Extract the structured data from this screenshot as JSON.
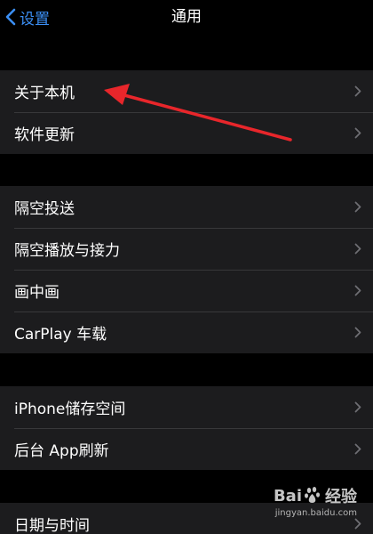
{
  "header": {
    "back_label": "设置",
    "title": "通用"
  },
  "groups": [
    {
      "items": [
        {
          "label": "关于本机"
        },
        {
          "label": "软件更新"
        }
      ]
    },
    {
      "items": [
        {
          "label": "隔空投送"
        },
        {
          "label": "隔空播放与接力"
        },
        {
          "label": "画中画"
        },
        {
          "label": "CarPlay 车载"
        }
      ]
    },
    {
      "items": [
        {
          "label": "iPhone储存空间"
        },
        {
          "label": "后台 App刷新"
        }
      ]
    },
    {
      "items": [
        {
          "label": "日期与时间"
        }
      ]
    }
  ],
  "colors": {
    "accent": "#3b8ff5",
    "annotation": "#e8262b",
    "cell_background": "#1c1c1e",
    "page_background": "#000000"
  },
  "watermark": {
    "brand_left": "Bai",
    "brand_right": "经验",
    "url": "jingyan.baidu.com"
  }
}
